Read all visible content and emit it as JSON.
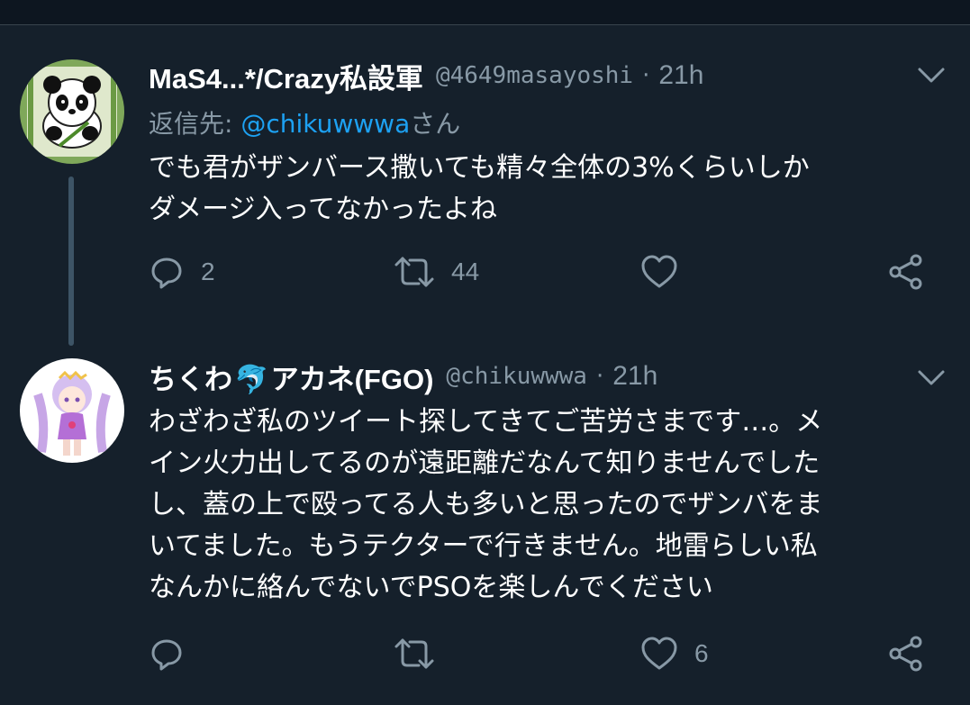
{
  "tweets": [
    {
      "name": "MaS4...*/Crazy私設軍",
      "handle": "@4649masayoshi",
      "separator": "·",
      "time": "21h",
      "reply_prefix": "返信先: ",
      "reply_mention": "@chikuwwwa",
      "reply_suffix": "さん",
      "text_lines": [
        "でも君がザンバース撒いても精々全体の3%くらいしか",
        "ダメージ入ってなかったよね"
      ],
      "reply_count": "2",
      "retweet_count": "44",
      "like_count": "",
      "avatar_icon": "panda-avatar"
    },
    {
      "name": "ちくわ",
      "name_emoji": "🐬",
      "name_rest": "アカネ(FGO)",
      "handle": "@chikuwwwa",
      "separator": "·",
      "time": "21h",
      "text_lines": [
        "わざわざ私のツイート探してきてご苦労さまです…。メ",
        "イン火力出してるのが遠距離だなんて知りませんでした",
        "し、蓋の上で殴ってる人も多いと思ったのでザンバをま",
        "いてました。もうテクターで行きません。地雷らしい私",
        "なんかに絡んでないでPSOを楽しんでください"
      ],
      "reply_count": "",
      "retweet_count": "",
      "like_count": "6",
      "avatar_icon": "anime-girl-avatar"
    }
  ],
  "colors": {
    "background": "#15202b",
    "secondary_text": "#8899a6",
    "link": "#1da1f2",
    "thread_line": "#3d5466"
  }
}
